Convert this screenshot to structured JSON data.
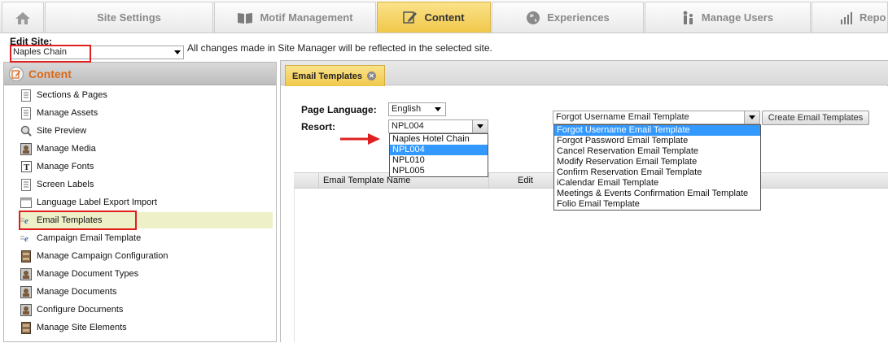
{
  "top_tabs": [
    {
      "label": "",
      "icon": "home-icon"
    },
    {
      "label": "Site Settings"
    },
    {
      "label": "Motif Management",
      "icon": "book-icon"
    },
    {
      "label": "Content",
      "icon": "edit-icon",
      "active": true
    },
    {
      "label": "Experiences",
      "icon": "globe-icon"
    },
    {
      "label": "Manage Users",
      "icon": "users-icon"
    },
    {
      "label": "Repo",
      "icon": "report-chart-icon"
    }
  ],
  "edit_site": {
    "label": "Edit Site:",
    "selected": "Naples Chain",
    "note": "All changes made in Site Manager will be reflected in the selected site."
  },
  "sidebar": {
    "title": "Content",
    "items": [
      {
        "label": "Sections & Pages",
        "icon": "page-icon"
      },
      {
        "label": "Manage Assets",
        "icon": "page-icon"
      },
      {
        "label": "Site Preview",
        "icon": "magnifier-icon"
      },
      {
        "label": "Manage Media",
        "icon": "media-icon"
      },
      {
        "label": "Manage Fonts",
        "icon": "font-icon"
      },
      {
        "label": "Screen Labels",
        "icon": "page-icon"
      },
      {
        "label": "Language Label Export Import",
        "icon": "label-icon"
      },
      {
        "label": "Email Templates",
        "icon": "email-e-icon",
        "selected": true
      },
      {
        "label": "Campaign Email Template",
        "icon": "email-e-icon"
      },
      {
        "label": "Manage Campaign Configuration",
        "icon": "cabinet-icon"
      },
      {
        "label": "Manage Document Types",
        "icon": "media-icon"
      },
      {
        "label": "Manage Documents",
        "icon": "media-icon"
      },
      {
        "label": "Configure Documents",
        "icon": "media-icon"
      },
      {
        "label": "Manage Site Elements",
        "icon": "cabinet-icon"
      }
    ]
  },
  "main": {
    "tab_label": "Email Templates",
    "page_language_label": "Page Language:",
    "page_language_value": "English",
    "resort_label": "Resort:",
    "resort_value": "NPL004",
    "resort_options": [
      "Naples Hotel Chain",
      "NPL004",
      "NPL010",
      "NPL005"
    ],
    "resort_selected_index": 1,
    "template_value": "Forgot Username Email Template",
    "template_options": [
      "Forgot Username Email Template",
      "Forgot Password Email Template",
      "Cancel Reservation Email Template",
      "Modify Reservation Email Template",
      "Confirm Reservation Email Template",
      "iCalendar Email Template",
      "Meetings & Events Confirmation Email Template",
      "Folio Email Template"
    ],
    "template_selected_index": 0,
    "create_button": "Create Email Templates",
    "grid_columns": [
      "Email Template Name",
      "Edit"
    ]
  },
  "colors": {
    "active_tab": "#f0c84a",
    "sidebar_title": "#d9691a",
    "highlight_box": "#e02020",
    "dropdown_selection": "#3399ff"
  }
}
